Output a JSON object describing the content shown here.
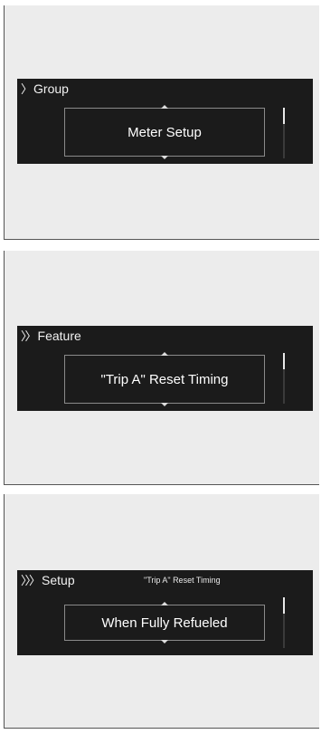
{
  "panels": [
    {
      "level_glyph": "〉",
      "title": "Group",
      "subtitle": "",
      "selection": "Meter Setup"
    },
    {
      "level_glyph": "〉〉",
      "title": "Feature",
      "subtitle": "",
      "selection": "\"Trip A\" Reset Timing"
    },
    {
      "level_glyph": "〉〉〉",
      "title": "Setup",
      "subtitle": "\"Trip A\" Reset Timing",
      "selection": "When Fully Refueled"
    }
  ],
  "colors": {
    "screen_background": "#1b1b1b",
    "panel_background": "#ececec",
    "text": "#ffffff"
  }
}
